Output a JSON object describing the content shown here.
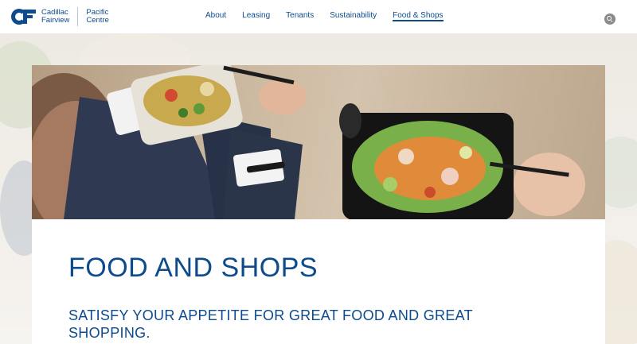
{
  "brand": {
    "logo_line1": "Cadillac",
    "logo_line2": "Fairview",
    "property_line1": "Pacific",
    "property_line2": "Centre"
  },
  "nav": {
    "items": [
      {
        "label": "About",
        "active": false
      },
      {
        "label": "Leasing",
        "active": false
      },
      {
        "label": "Tenants",
        "active": false
      },
      {
        "label": "Sustainability",
        "active": false
      },
      {
        "label": "Food & Shops",
        "active": true
      }
    ]
  },
  "search": {
    "icon": "search-icon"
  },
  "hero": {
    "image": "people eating salads from takeout containers"
  },
  "page": {
    "title": "FOOD AND SHOPS",
    "subtitle": "SATISFY YOUR APPETITE FOR GREAT FOOD AND GREAT SHOPPING."
  },
  "colors": {
    "brand_blue": "#0d4b8c",
    "search_grey": "#8a8a8a"
  }
}
